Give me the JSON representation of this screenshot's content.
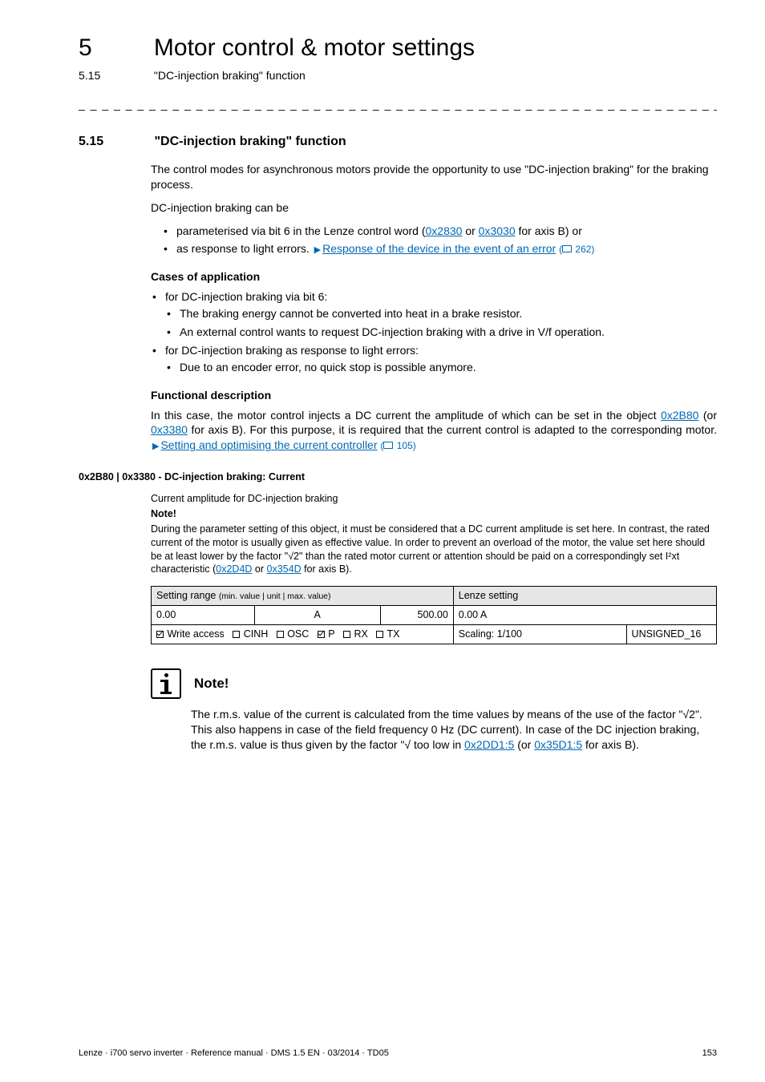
{
  "header": {
    "chapter_num": "5",
    "chapter_title": "Motor control & motor settings",
    "sub_num": "5.15",
    "sub_title": "\"DC-injection braking\" function"
  },
  "section": {
    "num": "5.15",
    "title": "\"DC-injection braking\" function",
    "intro": "The control modes for asynchronous motors provide the opportunity to use \"DC-injection braking\" for the braking process.",
    "line2": "DC-injection braking can be",
    "bullet1_pre": "parameterised via bit 6 in the Lenze control word (",
    "bullet1_link1": "0x2830",
    "bullet1_or": " or ",
    "bullet1_link2": "0x3030",
    "bullet1_post": " for axis B) or",
    "bullet2_pre": "as response to light errors.  ",
    "bullet2_link": "Response of the device in the event of an error",
    "bullet2_page": " 262)"
  },
  "cases": {
    "heading": "Cases of application",
    "b1": "for DC-injection braking via bit 6:",
    "b1a": "The braking energy cannot be converted into heat in a brake resistor.",
    "b1b": "An external control wants to request DC-injection braking with a drive in V/f operation.",
    "b2": "for DC-injection braking as response to light errors:",
    "b2a": "Due to an encoder error, no quick stop is possible anymore."
  },
  "func": {
    "heading": "Functional description",
    "text_pre": "In this case, the motor control injects a DC current the amplitude of which can be set in the object ",
    "link1": "0x2B80",
    "mid1": " (or ",
    "link2": "0x3380",
    "mid2": " for axis B). For this purpose, it is required that the current control is adapted to the corresponding motor.  ",
    "link3": "Setting and optimising the current controller",
    "page": " 105)"
  },
  "param": {
    "heading": "0x2B80 | 0x3380 - DC-injection braking: Current",
    "desc1": "Current amplitude for DC-injection braking",
    "note_label": "Note!",
    "desc2_pre": "During the parameter setting of this object, it must be considered that a DC current amplitude is set here. In contrast, the rated current of the motor is usually given as effective value. In order to prevent an overload of the motor, the value set here should be at least lower by the factor \"√2\" than the rated motor current or attention should be paid on a correspondingly set I²xt characteristic (",
    "desc2_link1": "0x2D4D",
    "desc2_or": " or ",
    "desc2_link2": "0x354D",
    "desc2_post": " for axis B).",
    "th_left": "Setting range ",
    "th_left_small": "(min. value | unit | max. value)",
    "th_right": "Lenze setting",
    "row1_min": "0.00",
    "row1_unit": "A",
    "row1_max": "500.00",
    "row1_default": "0.00 A",
    "row2_write": "Write access",
    "row2_cinh": "CINH",
    "row2_osc": "OSC",
    "row2_p": "P",
    "row2_rx": "RX",
    "row2_tx": "TX",
    "row2_scaling": "Scaling: 1/100",
    "row2_type": "UNSIGNED_16"
  },
  "note": {
    "title": "Note!",
    "body_pre": "The r.m.s. value of the current is calculated from the time values by means of the use of the factor \"√2\". This also happens in case of the field frequency 0 Hz (DC current). In case of the DC injection braking, the r.m.s. value is thus given by the factor \"√ too low in ",
    "link1": "0x2DD1:5",
    "mid": " (or ",
    "link2": "0x35D1:5",
    "post": " for axis B)."
  },
  "footer": {
    "left": "Lenze · i700 servo inverter · Reference manual · DMS 1.5 EN · 03/2014 · TD05",
    "right": "153"
  },
  "chart_data": {
    "type": "table",
    "title": "0x2B80 | 0x3380 - DC-injection braking: Current — parameter table",
    "columns": [
      "min_value",
      "unit",
      "max_value",
      "lenze_setting"
    ],
    "rows": [
      {
        "min_value": 0.0,
        "unit": "A",
        "max_value": 500.0,
        "lenze_setting": "0.00 A"
      }
    ],
    "attributes": {
      "write_access": true,
      "CINH": false,
      "OSC": false,
      "P": true,
      "RX": false,
      "TX": false,
      "scaling": "1/100",
      "data_type": "UNSIGNED_16"
    }
  }
}
